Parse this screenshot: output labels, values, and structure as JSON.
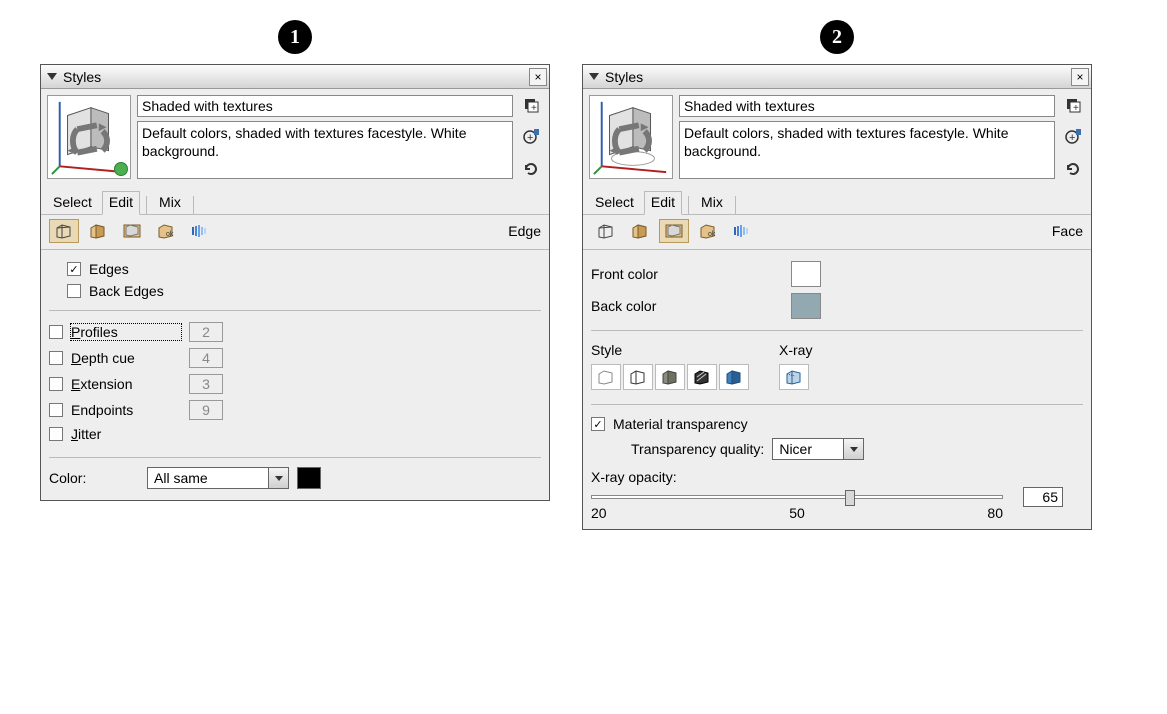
{
  "badges": {
    "one": "1",
    "two": "2"
  },
  "panel": {
    "title": "Styles",
    "style_name": "Shaded with textures",
    "style_desc": "Default colors, shaded with textures facestyle. White background."
  },
  "tabs": {
    "select": "Select",
    "edit": "Edit",
    "mix": "Mix"
  },
  "left": {
    "section_label": "Edge",
    "edges": "Edges",
    "back_edges": "Back Edges",
    "profiles": "rofiles",
    "profiles_val": "2",
    "depth_cue": "epth cue",
    "depth_cue_val": "4",
    "extension": "xtension",
    "extension_val": "3",
    "endpoints": "Endpoints",
    "endpoints_val": "9",
    "jitter": "itter",
    "color_label": "Color:",
    "color_value": "All same",
    "color_swatch": "#000000"
  },
  "right": {
    "section_label": "Face",
    "front_color": "Front color",
    "front_swatch": "#ffffff",
    "back_color": "Back color",
    "back_swatch": "#93a9b1",
    "style_label": "Style",
    "xray_label": "X-ray",
    "mat_trans": "Material transparency",
    "trans_quality": "Transparency quality:",
    "trans_value": "Nicer",
    "xray_opacity": "X-ray opacity:",
    "opacity_val": "65",
    "ticks": {
      "a": "20",
      "b": "50",
      "c": "80"
    }
  }
}
